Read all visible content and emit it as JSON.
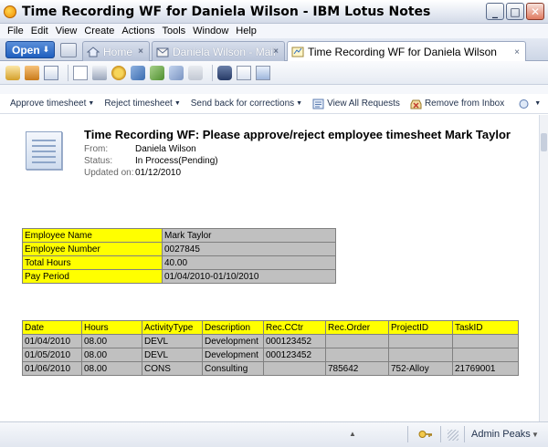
{
  "window": {
    "title": "Time Recording WF for Daniela Wilson - IBM Lotus Notes",
    "buttons": {
      "minimize": "_",
      "maximize": "□",
      "close": "✕"
    }
  },
  "menu": [
    "File",
    "Edit",
    "View",
    "Create",
    "Actions",
    "Tools",
    "Window",
    "Help"
  ],
  "tabs": {
    "open_label": "Open",
    "items": [
      {
        "label": "Home",
        "close": "×"
      },
      {
        "label": "Daniela Wilson - Mail",
        "close": "×"
      },
      {
        "label": "Time Recording WF for Daniela Wilson",
        "close": "×"
      }
    ]
  },
  "actions": [
    {
      "label": "Approve timesheet",
      "dropdown": "▼"
    },
    {
      "label": "Reject timesheet",
      "dropdown": "▼"
    },
    {
      "label": "Send back for corrections",
      "dropdown": "▼"
    },
    {
      "label": "View All Requests"
    },
    {
      "label": "Remove from Inbox"
    }
  ],
  "document": {
    "subject": "Time Recording WF: Please approve/reject employee timesheet Mark Taylor",
    "from_label": "From:",
    "from": "Daniela Wilson",
    "status_label": "Status:",
    "status": "In Process(Pending)",
    "updated_label": "Updated on:",
    "updated": "01/12/2010"
  },
  "employee": {
    "rows": [
      {
        "label": "Employee Name",
        "value": "Mark Taylor"
      },
      {
        "label": "Employee Number",
        "value": "0027845"
      },
      {
        "label": "Total Hours",
        "value": "40.00"
      },
      {
        "label": "Pay Period",
        "value": "01/04/2010-01/10/2010"
      }
    ]
  },
  "activities": {
    "headers": [
      "Date",
      "Hours",
      "ActivityType",
      "Description",
      "Rec.CCtr",
      "Rec.Order",
      "ProjectID",
      "TaskID"
    ],
    "rows": [
      [
        "01/04/2010",
        "08.00",
        "DEVL",
        "Development",
        "000123452",
        "",
        "",
        ""
      ],
      [
        "01/05/2010",
        "08.00",
        "DEVL",
        "Development",
        "000123452",
        "",
        "",
        ""
      ],
      [
        "01/06/2010",
        "08.00",
        "CONS",
        "Consulting",
        "",
        "785642",
        "752-Alloy",
        "21769001"
      ]
    ]
  },
  "statusbar": {
    "user": "Admin Peaks",
    "up_arrow": "▲",
    "dropdown": "▼"
  },
  "icons": [
    "app-icon",
    "open-arrow-icon",
    "home-icon",
    "mail-icon",
    "workflow-icon",
    "approve-icon",
    "reject-icon",
    "requests-icon",
    "remove-inbox-icon",
    "search-icon",
    "key-icon",
    "document-icon"
  ]
}
